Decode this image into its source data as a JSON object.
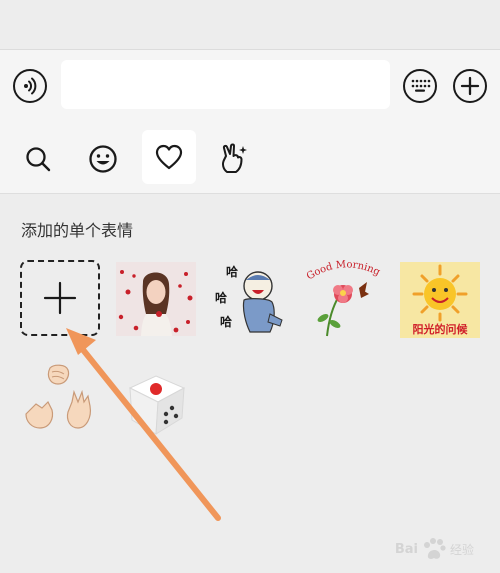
{
  "input_bar": {
    "voice_icon": "voice-input-icon",
    "text_value": "",
    "keyboard_icon": "keyboard-icon",
    "add_icon": "plus-circle-icon"
  },
  "tabs": [
    {
      "icon": "search-icon",
      "selected": false
    },
    {
      "icon": "smiley-icon",
      "selected": false
    },
    {
      "icon": "heart-icon",
      "selected": true
    },
    {
      "icon": "hand-gesture-icon",
      "selected": false
    }
  ],
  "favorites": {
    "section_title": "添加的单个表情",
    "add_button_icon": "plus-icon",
    "stickers": [
      {
        "name": "woman-photo-sticker"
      },
      {
        "name": "cartoon-laughing-sticker",
        "caption": "哈哈哈"
      },
      {
        "name": "good-morning-flower-sticker",
        "caption": "Good Morning"
      },
      {
        "name": "sunshine-greeting-sticker",
        "caption": "阳光的问候"
      },
      {
        "name": "rock-paper-scissors-sticker"
      },
      {
        "name": "dice-sticker"
      }
    ]
  },
  "watermark": {
    "brand": "Bai",
    "suffix": "经验"
  },
  "colors": {
    "accent_arrow": "#f0965a",
    "panel_bg": "#ededed",
    "bar_bg": "#f5f5f5"
  }
}
